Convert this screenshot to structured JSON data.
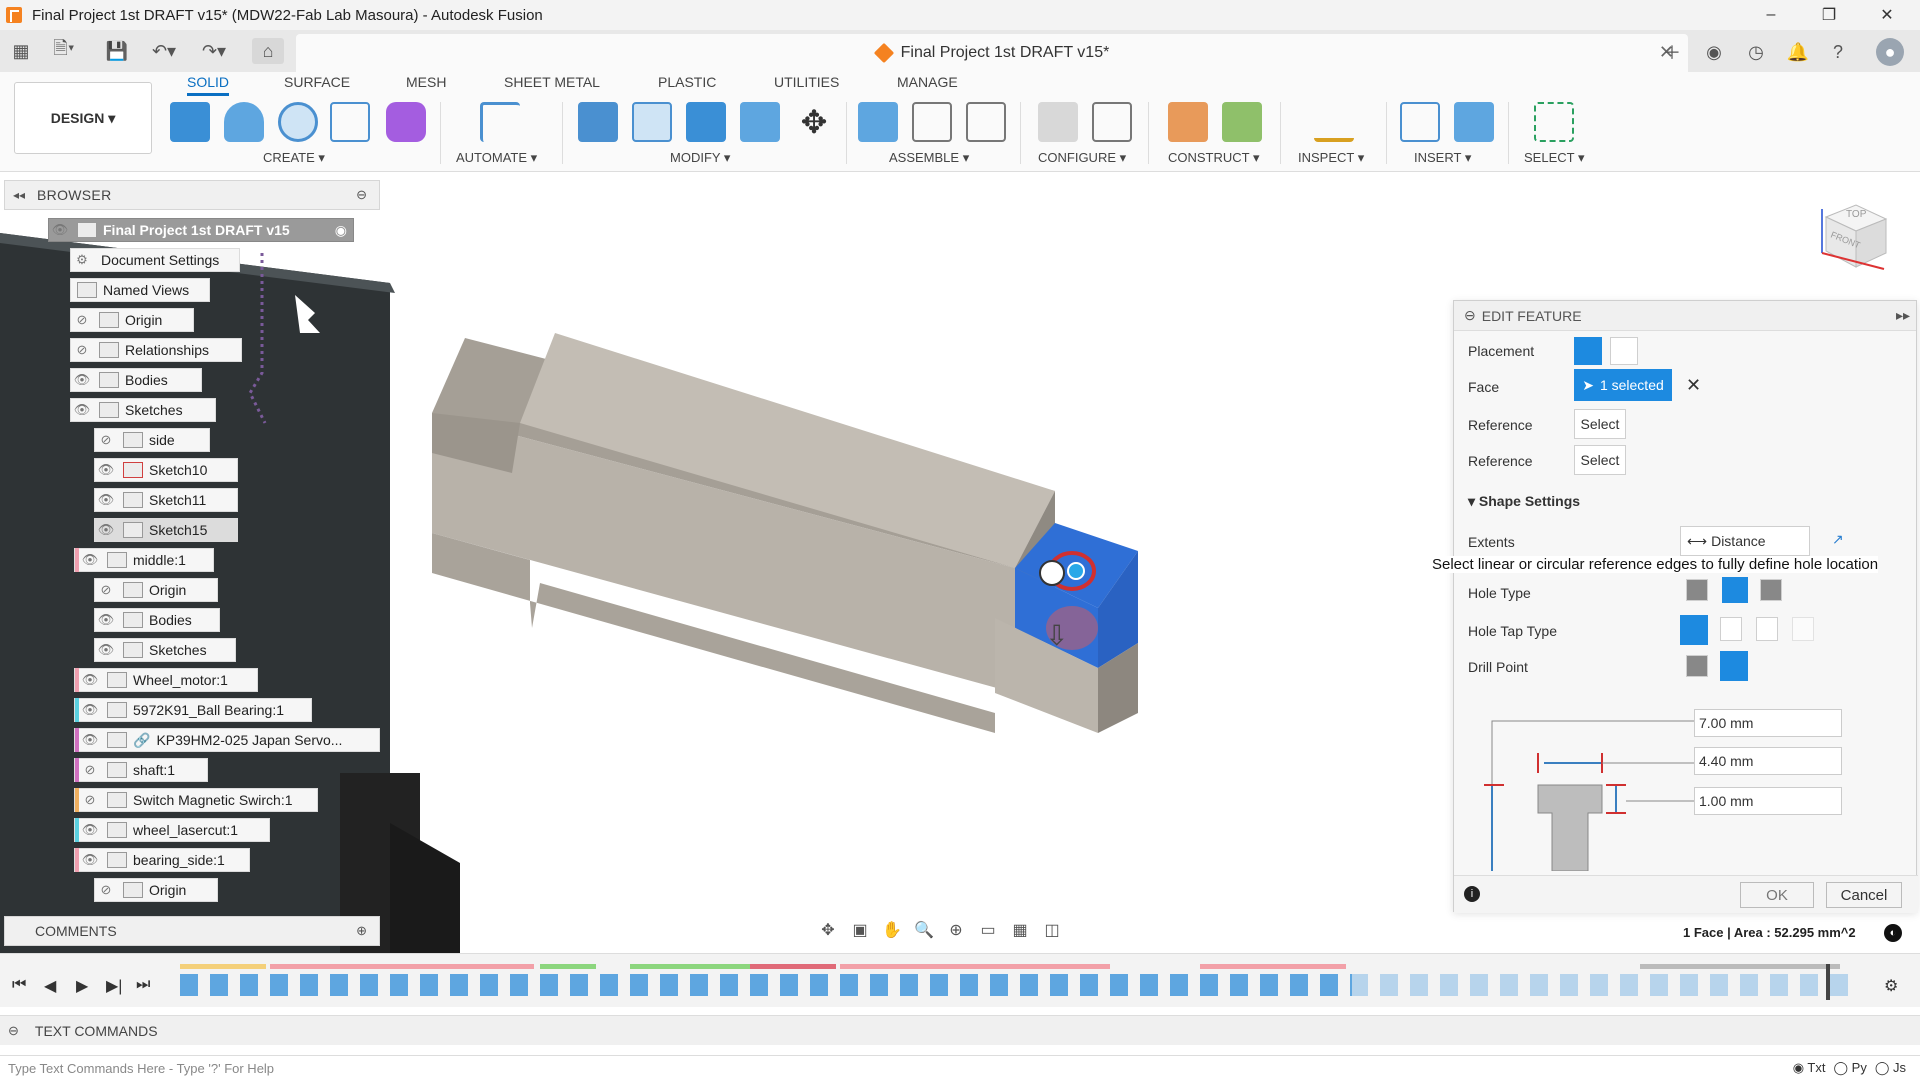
{
  "window": {
    "title": "Final Project 1st DRAFT v15* (MDW22-Fab Lab Masoura) - Autodesk Fusion",
    "controls": [
      "–",
      "❐",
      "✕"
    ]
  },
  "document_tab": {
    "name": "Final Project 1st DRAFT v15*",
    "close": "✕"
  },
  "toolbar": {
    "design_button": "DESIGN ▾",
    "workspace_tabs": [
      "SOLID",
      "SURFACE",
      "MESH",
      "SHEET METAL",
      "PLASTIC",
      "UTILITIES",
      "MANAGE"
    ],
    "active_tab": "SOLID",
    "groups": [
      "CREATE ▾",
      "AUTOMATE ▾",
      "MODIFY ▾",
      "ASSEMBLE ▾",
      "CONFIGURE ▾",
      "CONSTRUCT ▾",
      "INSPECT ▾",
      "INSERT ▾",
      "SELECT ▾"
    ]
  },
  "browser": {
    "header": "BROWSER",
    "root": "Final Project 1st DRAFT v15",
    "items": [
      {
        "label": "Document Settings"
      },
      {
        "label": "Named Views"
      },
      {
        "label": "Origin"
      },
      {
        "label": "Relationships"
      },
      {
        "label": "Bodies"
      },
      {
        "label": "Sketches"
      },
      {
        "label": "side"
      },
      {
        "label": "Sketch10"
      },
      {
        "label": "Sketch11"
      },
      {
        "label": "Sketch15"
      },
      {
        "label": "middle:1"
      },
      {
        "label": "Origin"
      },
      {
        "label": "Bodies"
      },
      {
        "label": "Sketches"
      },
      {
        "label": "Wheel_motor:1"
      },
      {
        "label": "5972K91_Ball Bearing:1"
      },
      {
        "label": "KP39HM2-025 Japan Servo..."
      },
      {
        "label": "shaft:1"
      },
      {
        "label": "Switch Magnetic Swirch:1"
      },
      {
        "label": "wheel_lasercut:1"
      },
      {
        "label": "bearing_side:1"
      },
      {
        "label": "Origin"
      }
    ]
  },
  "comments": {
    "header": "COMMENTS"
  },
  "edit_feature": {
    "header": "EDIT FEATURE",
    "placement_label": "Placement",
    "face_label": "Face",
    "face_value": "1 selected",
    "reference_label_1": "Reference",
    "reference_value_1": "Select",
    "reference_label_2": "Reference",
    "reference_value_2": "Select",
    "shape_settings": "Shape Settings",
    "extents_label": "Extents",
    "extents_value": "Distance",
    "tooltip": "Select linear or circular reference edges to fully define hole location",
    "hole_type_label": "Hole Type",
    "hole_tap_type_label": "Hole Tap Type",
    "drill_point_label": "Drill Point",
    "dims": [
      "7.00 mm",
      "4.40 mm",
      "1.00 mm"
    ],
    "ok": "OK",
    "cancel": "Cancel"
  },
  "status": {
    "selection": "1 Face | Area : 52.295 mm^2"
  },
  "viewcube": {
    "top": "TOP",
    "front": "FRONT"
  },
  "text_commands": {
    "header": "TEXT COMMANDS",
    "placeholder": "Type Text Commands Here - Type '?' For Help",
    "modes": [
      "Txt",
      "Py",
      "Js"
    ]
  },
  "colors": {
    "accent": "#0a6fc2",
    "selected": "#1d8ae0",
    "model": "#bcb6ad"
  }
}
